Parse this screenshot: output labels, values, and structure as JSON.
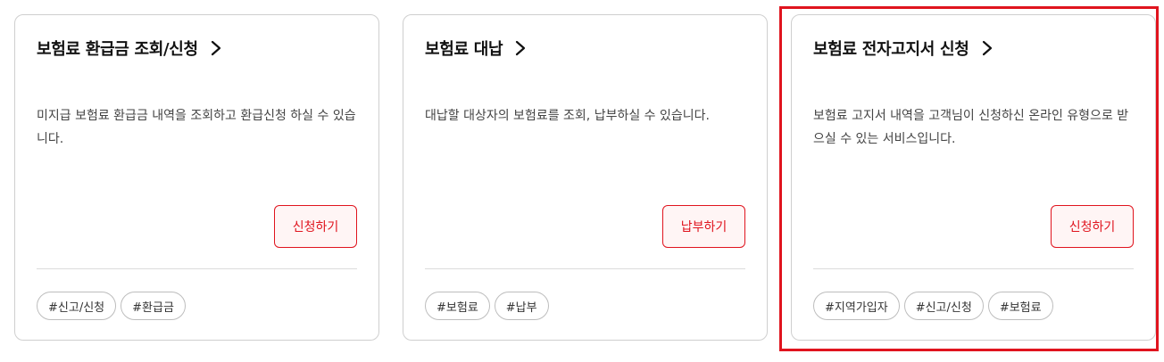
{
  "cards": [
    {
      "title": "보험료 환급금 조회/신청",
      "description": "미지급 보험료 환급금 내역을 조회하고 환급신청 하실 수 있습니다.",
      "button_label": "신청하기",
      "tags": [
        "#신고/신청",
        "#환급금"
      ]
    },
    {
      "title": "보험료 대납",
      "description": "대납할 대상자의 보험료를 조회, 납부하실 수 있습니다.",
      "button_label": "납부하기",
      "tags": [
        "#보험료",
        "#납부"
      ]
    },
    {
      "title": "보험료 전자고지서 신청",
      "description": "보험료 고지서 내역을 고객님이 신청하신 온라인 유형으로 받으실 수 있는 서비스입니다.",
      "button_label": "신청하기",
      "tags": [
        "#지역가입자",
        "#신고/신청",
        "#보험료"
      ]
    }
  ],
  "colors": {
    "accent": "#e0141e",
    "button_bg": "#fff5f5",
    "card_border": "#cfcfcf"
  },
  "icons": {
    "title_arrow": "chevron-right-icon"
  }
}
